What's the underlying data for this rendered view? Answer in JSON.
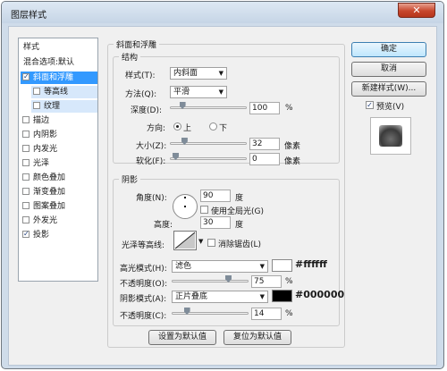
{
  "window": {
    "title": "图层样式",
    "close_glyph": "✕"
  },
  "left_panel": {
    "styles_label": "样式",
    "blend_options": "混合选项:默认",
    "items": [
      {
        "label": "斜面和浮雕",
        "checked": true,
        "selected": true
      },
      {
        "label": "等高线",
        "checked": false,
        "sub": true
      },
      {
        "label": "纹理",
        "checked": false,
        "sub": true
      },
      {
        "label": "描边",
        "checked": false
      },
      {
        "label": "内阴影",
        "checked": false
      },
      {
        "label": "内发光",
        "checked": false
      },
      {
        "label": "光泽",
        "checked": false
      },
      {
        "label": "颜色叠加",
        "checked": false
      },
      {
        "label": "渐变叠加",
        "checked": false
      },
      {
        "label": "图案叠加",
        "checked": false
      },
      {
        "label": "外发光",
        "checked": false
      },
      {
        "label": "投影",
        "checked": true
      }
    ]
  },
  "bevel": {
    "title": "斜面和浮雕",
    "structure": {
      "title": "结构",
      "style_label": "样式(T):",
      "style_value": "内斜面",
      "technique_label": "方法(Q):",
      "technique_value": "平滑",
      "depth_label": "深度(D):",
      "depth_value": "100",
      "depth_unit": "%",
      "depth_level": 0.1,
      "direction_label": "方向:",
      "dir_up": "上",
      "dir_down": "下",
      "dir_selected": "上",
      "size_label": "大小(Z):",
      "size_value": "32",
      "size_unit": "像素",
      "size_level": 0.13,
      "soften_label": "软化(F):",
      "soften_value": "0",
      "soften_unit": "像素",
      "soften_level": 0.0
    },
    "shading": {
      "title": "阴影",
      "angle_label": "角度(N):",
      "angle_value": "90",
      "angle_unit": "度",
      "global_light_label": "使用全局光(G)",
      "global_light_checked": false,
      "altitude_label": "高度:",
      "altitude_value": "30",
      "altitude_unit": "度",
      "gloss_label": "光泽等高线:",
      "antialias_label": "消除锯齿(L)",
      "antialias_checked": false,
      "highlight_label": "高光模式(H):",
      "highlight_mode": "滤色",
      "highlight_color": "#ffffff",
      "highlight_text": "#ffffff",
      "hl_opacity_label": "不透明度(O):",
      "hl_opacity_value": "75",
      "hl_opacity_unit": "%",
      "hl_opacity_level": 0.75,
      "shadow_label": "阴影模式(A):",
      "shadow_mode": "正片叠底",
      "shadow_color": "#000000",
      "shadow_text": "#000000",
      "sh_opacity_label": "不透明度(C):",
      "sh_opacity_value": "14",
      "sh_opacity_unit": "%",
      "sh_opacity_level": 0.14
    },
    "make_default": "设置为默认值",
    "reset_default": "复位为默认值"
  },
  "right": {
    "ok": "确定",
    "cancel": "取消",
    "new_style": "新建样式(W)...",
    "preview_label": "预览(V)",
    "preview_checked": true
  }
}
